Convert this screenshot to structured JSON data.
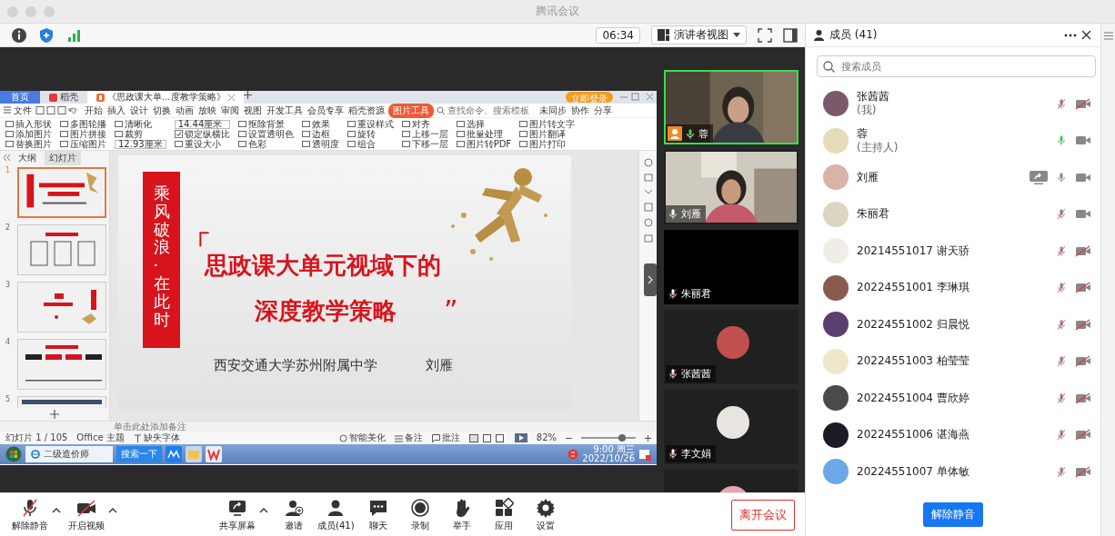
{
  "window": {
    "title": "腾讯会议"
  },
  "toolbar": {
    "timer": "06:34",
    "view_mode": "演讲者视图"
  },
  "shared_screen": {
    "tabs": [
      {
        "label": "首页",
        "kind": "home",
        "selected": false
      },
      {
        "label": "稻壳",
        "kind": "docer",
        "selected": false
      },
      {
        "label": "《思政课大单...度教学策略》",
        "kind": "document",
        "selected": true
      }
    ],
    "login_button": "立即登录",
    "menu": {
      "file": "文件",
      "tabs": [
        {
          "label": "开始",
          "selected": false
        },
        {
          "label": "插入",
          "selected": false
        },
        {
          "label": "设计",
          "selected": false
        },
        {
          "label": "切换",
          "selected": false
        },
        {
          "label": "动画",
          "selected": false
        },
        {
          "label": "放映",
          "selected": false
        },
        {
          "label": "审阅",
          "selected": false
        },
        {
          "label": "视图",
          "selected": false
        },
        {
          "label": "开发工具",
          "selected": false
        },
        {
          "label": "会员专享",
          "selected": false
        },
        {
          "label": "稻壳资源",
          "selected": false
        },
        {
          "label": "图片工具",
          "selected": true
        }
      ],
      "search": {
        "placeholder": "查找命令、搜索模板"
      },
      "actions": [
        "未同步",
        "协作",
        "分享"
      ]
    },
    "ribbon": [
      {
        "label": "插入形状",
        "kind": "button"
      },
      {
        "label": "添加图片",
        "kind": "button"
      },
      {
        "label": "替换图片",
        "kind": "button"
      },
      {
        "label": "多图轮播",
        "kind": "button"
      },
      {
        "label": "图片拼接",
        "kind": "button"
      },
      {
        "label": "压缩图片",
        "kind": "button"
      },
      {
        "label": "清晰化",
        "kind": "button"
      },
      {
        "label": "裁剪",
        "kind": "button"
      },
      {
        "label": "12.93厘米",
        "kind": "field"
      },
      {
        "label": "14.44厘米",
        "kind": "field"
      },
      {
        "label": "锁定纵横比",
        "kind": "checkbox",
        "checked": true
      },
      {
        "label": "重设大小",
        "kind": "button"
      },
      {
        "label": "抠除背景",
        "kind": "button"
      },
      {
        "label": "设置透明色",
        "kind": "button"
      },
      {
        "label": "色彩",
        "kind": "button"
      },
      {
        "label": "效果",
        "kind": "button"
      },
      {
        "label": "边框",
        "kind": "button"
      },
      {
        "label": "透明度",
        "kind": "button"
      },
      {
        "label": "重设样式",
        "kind": "button"
      },
      {
        "label": "旋转",
        "kind": "button"
      },
      {
        "label": "组合",
        "kind": "button"
      },
      {
        "label": "对齐",
        "kind": "button"
      },
      {
        "label": "上移一层",
        "kind": "button"
      },
      {
        "label": "下移一层",
        "kind": "button"
      },
      {
        "label": "选择",
        "kind": "button"
      },
      {
        "label": "批量处理",
        "kind": "button"
      },
      {
        "label": "图片转PDF",
        "kind": "button"
      },
      {
        "label": "图片转文字",
        "kind": "button"
      },
      {
        "label": "图片翻译",
        "kind": "button"
      },
      {
        "label": "图片打印",
        "kind": "button"
      }
    ],
    "panel_tabs": [
      {
        "label": "大纲",
        "selected": false
      },
      {
        "label": "幻灯片",
        "selected": true
      }
    ],
    "thumbnails": [
      {
        "number": "1",
        "kind": "title",
        "selected": true
      },
      {
        "number": "2",
        "kind": "contents",
        "selected": false
      },
      {
        "number": "3",
        "kind": "section",
        "selected": false
      },
      {
        "number": "4",
        "kind": "contents-dark",
        "selected": false
      },
      {
        "number": "5",
        "kind": "text",
        "selected": false
      }
    ],
    "slide": {
      "banner": "乘风破浪·在此时",
      "open_mark": "「",
      "title_lines": [
        "思政课大单元视域下的",
        "深度教学策略"
      ],
      "close_mark": "”",
      "school": "西安交通大学苏州附属中学",
      "author": "刘雁"
    },
    "notes": {
      "placeholder": "单击此处添加备注"
    },
    "status_bar": {
      "slide_count": "幻灯片 1 / 105",
      "theme": "Office 主题",
      "missing_fonts": "缺失字体",
      "beautify": "智能美化",
      "notes": "备注",
      "comments": "批注",
      "zoom": "82%",
      "zoom_slider": {
        "level": 0.75
      }
    },
    "taskbar": {
      "browser_tab": "二级造价师",
      "search_button": "搜索一下",
      "time": "9:00 周三",
      "date": "2022/10/26"
    }
  },
  "video_tiles": [
    {
      "name": "蓉",
      "kind": "camera",
      "speaking": true,
      "host": true,
      "muted": false
    },
    {
      "name": "刘雁",
      "kind": "camera",
      "speaking": false,
      "host": false,
      "muted": false
    },
    {
      "name": "朱丽君",
      "kind": "blank",
      "speaking": false,
      "host": false,
      "muted": true
    },
    {
      "name": "张茜茜",
      "kind": "avatar",
      "color": "#c0504d",
      "speaking": false,
      "host": false,
      "muted": true
    },
    {
      "name": "李文娟",
      "kind": "avatar",
      "color": "#e8e4df",
      "speaking": false,
      "host": false,
      "muted": true
    },
    {
      "kind": "avatar",
      "color": "#e9a6b0",
      "speaking": false
    }
  ],
  "bottom_bar": {
    "left": [
      {
        "label": "解除静音",
        "kind": "mic-muted",
        "has_menu": true
      },
      {
        "label": "开启视频",
        "kind": "video-off",
        "has_menu": true
      }
    ],
    "center": [
      {
        "label": "共享屏幕",
        "kind": "share",
        "has_menu": true
      },
      {
        "label": "邀请",
        "kind": "invite",
        "has_menu": false
      },
      {
        "label": "成员(41)",
        "kind": "members",
        "has_menu": false
      },
      {
        "label": "聊天",
        "kind": "chat",
        "has_menu": false
      },
      {
        "label": "录制",
        "kind": "record",
        "has_menu": false
      },
      {
        "label": "举手",
        "kind": "hand",
        "has_menu": false
      },
      {
        "label": "应用",
        "kind": "apps",
        "has_menu": false
      },
      {
        "label": "设置",
        "kind": "settings",
        "has_menu": false
      }
    ],
    "leave_button": "离开会议"
  },
  "members_panel": {
    "title": "成员 (41)",
    "search": {
      "placeholder": "搜索成员"
    },
    "members": [
      {
        "name": "张茜茜",
        "role": "(我)",
        "color": "#7a5a6a",
        "sharing": false,
        "muted": true,
        "speaking": false,
        "camera_on": false
      },
      {
        "name": "蓉",
        "role": "(主持人)",
        "color": "#e6dcb8",
        "sharing": false,
        "muted": false,
        "speaking": true,
        "camera_on": true
      },
      {
        "name": "刘雁",
        "color": "#d9b2a8",
        "sharing": true,
        "muted": false,
        "speaking": false,
        "camera_on": true
      },
      {
        "name": "朱丽君",
        "color": "#dcd6c0",
        "sharing": false,
        "muted": true,
        "speaking": false,
        "camera_on": true
      },
      {
        "name": "20214551017 谢天骄",
        "color": "#f0ece8",
        "sharing": false,
        "muted": true,
        "speaking": false,
        "camera_on": false
      },
      {
        "name": "20224551001 李琳琪",
        "color": "#8a5a50",
        "sharing": false,
        "muted": true,
        "speaking": false,
        "camera_on": false
      },
      {
        "name": "20224551002 归晨悦",
        "color": "#5a4070",
        "sharing": false,
        "muted": true,
        "speaking": false,
        "camera_on": false
      },
      {
        "name": "20224551003 柏莹莹",
        "color": "#eee8c8",
        "sharing": false,
        "muted": true,
        "speaking": false,
        "camera_on": false
      },
      {
        "name": "20224551004 曹欣婷",
        "color": "#4a4a48",
        "sharing": false,
        "muted": true,
        "speaking": false,
        "camera_on": false
      },
      {
        "name": "20224551006 谌海燕",
        "color": "#1c1c24",
        "sharing": false,
        "muted": true,
        "speaking": false,
        "camera_on": false
      },
      {
        "name": "20224551007 单体敏",
        "color": "#6aa8e8",
        "sharing": false,
        "muted": true,
        "speaking": false,
        "camera_on": false
      }
    ],
    "unmute_all_button": "解除静音"
  }
}
